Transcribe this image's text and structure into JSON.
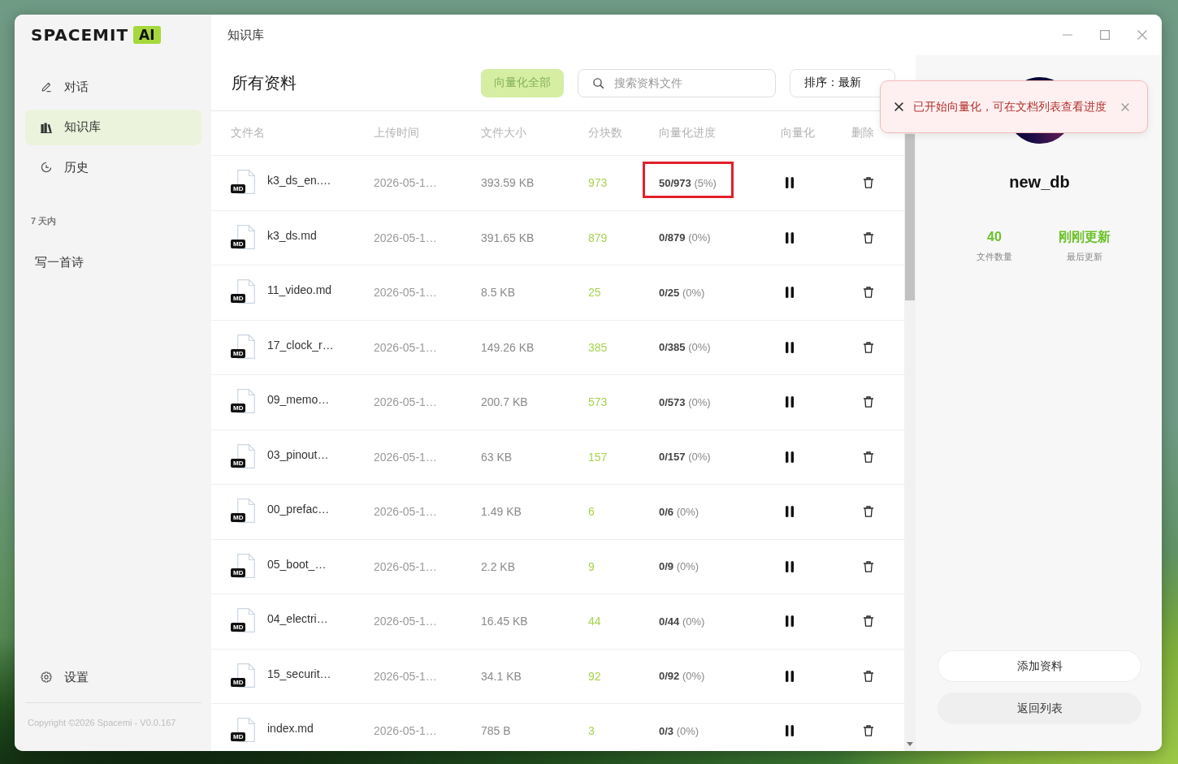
{
  "window": {
    "title": "知识库"
  },
  "sidebar": {
    "logo": {
      "text": "SPACEMIT",
      "badge": "AI"
    },
    "nav": [
      {
        "label": "对话",
        "kind": "chat",
        "selected": false
      },
      {
        "label": "知识库",
        "kind": "library",
        "selected": true
      },
      {
        "label": "历史",
        "kind": "history",
        "selected": false
      }
    ],
    "history_group": "7 天内",
    "history_items": [
      "写一首诗"
    ],
    "settings": "设置",
    "copyright": "Copyright ©2026 Spacemi - V0.0.167"
  },
  "main": {
    "heading": "所有资料",
    "vectorize_all_button": "向量化全部",
    "search": {
      "placeholder": "搜索资料文件"
    },
    "sort_button": "排序：最新"
  },
  "table": {
    "columns": [
      "文件名",
      "上传时间",
      "文件大小",
      "分块数",
      "向量化进度",
      "向量化",
      "删除"
    ],
    "rows": [
      {
        "type": "MD",
        "name": "k3_ds_en.…",
        "uploaded": "2026-05-1…",
        "size": "393.59 KB",
        "chunks": "973",
        "progress": "**50/973** (5%)",
        "vectorizing": true,
        "highlighted": true
      },
      {
        "type": "MD",
        "name": "k3_ds.md",
        "uploaded": "2026-05-1…",
        "size": "391.65 KB",
        "chunks": "879",
        "progress": "**0/879** (0%)",
        "vectorizing": true,
        "highlighted": false
      },
      {
        "type": "MD",
        "name": "11_video.md",
        "uploaded": "2026-05-1…",
        "size": "8.5 KB",
        "chunks": "25",
        "progress": "**0/25** (0%)",
        "vectorizing": true,
        "highlighted": false
      },
      {
        "type": "MD",
        "name": "17_clock_r…",
        "uploaded": "2026-05-1…",
        "size": "149.26 KB",
        "chunks": "385",
        "progress": "**0/385** (0%)",
        "vectorizing": true,
        "highlighted": false
      },
      {
        "type": "MD",
        "name": "09_memo…",
        "uploaded": "2026-05-1…",
        "size": "200.7 KB",
        "chunks": "573",
        "progress": "**0/573** (0%)",
        "vectorizing": true,
        "highlighted": false
      },
      {
        "type": "MD",
        "name": "03_pinout…",
        "uploaded": "2026-05-1…",
        "size": "63 KB",
        "chunks": "157",
        "progress": "**0/157** (0%)",
        "vectorizing": true,
        "highlighted": false
      },
      {
        "type": "MD",
        "name": "00_prefac…",
        "uploaded": "2026-05-1…",
        "size": "1.49 KB",
        "chunks": "6",
        "progress": "**0/6** (0%)",
        "vectorizing": true,
        "highlighted": false
      },
      {
        "type": "MD",
        "name": "05_boot_…",
        "uploaded": "2026-05-1…",
        "size": "2.2 KB",
        "chunks": "9",
        "progress": "**0/9** (0%)",
        "vectorizing": true,
        "highlighted": false
      },
      {
        "type": "MD",
        "name": "04_electri…",
        "uploaded": "2026-05-1…",
        "size": "16.45 KB",
        "chunks": "44",
        "progress": "**0/44** (0%)",
        "vectorizing": true,
        "highlighted": false
      },
      {
        "type": "MD",
        "name": "15_securit…",
        "uploaded": "2026-05-1…",
        "size": "34.1 KB",
        "chunks": "92",
        "progress": "**0/92** (0%)",
        "vectorizing": true,
        "highlighted": false
      },
      {
        "type": "MD",
        "name": "index.md",
        "uploaded": "2026-05-1…",
        "size": "785 B",
        "chunks": "3",
        "progress": "**0/3** (0%)",
        "vectorizing": true,
        "highlighted": false
      }
    ]
  },
  "toast": {
    "message": "已开始向量化，可在文档列表查看进度"
  },
  "details": {
    "name": "new_db",
    "stats": [
      {
        "value": "40",
        "label": "文件数量"
      },
      {
        "value": "刚刚更新",
        "label": "最后更新"
      }
    ],
    "buttons": [
      {
        "label": "添加资料",
        "kind": "outline"
      },
      {
        "label": "返回列表",
        "kind": "filled"
      }
    ]
  }
}
